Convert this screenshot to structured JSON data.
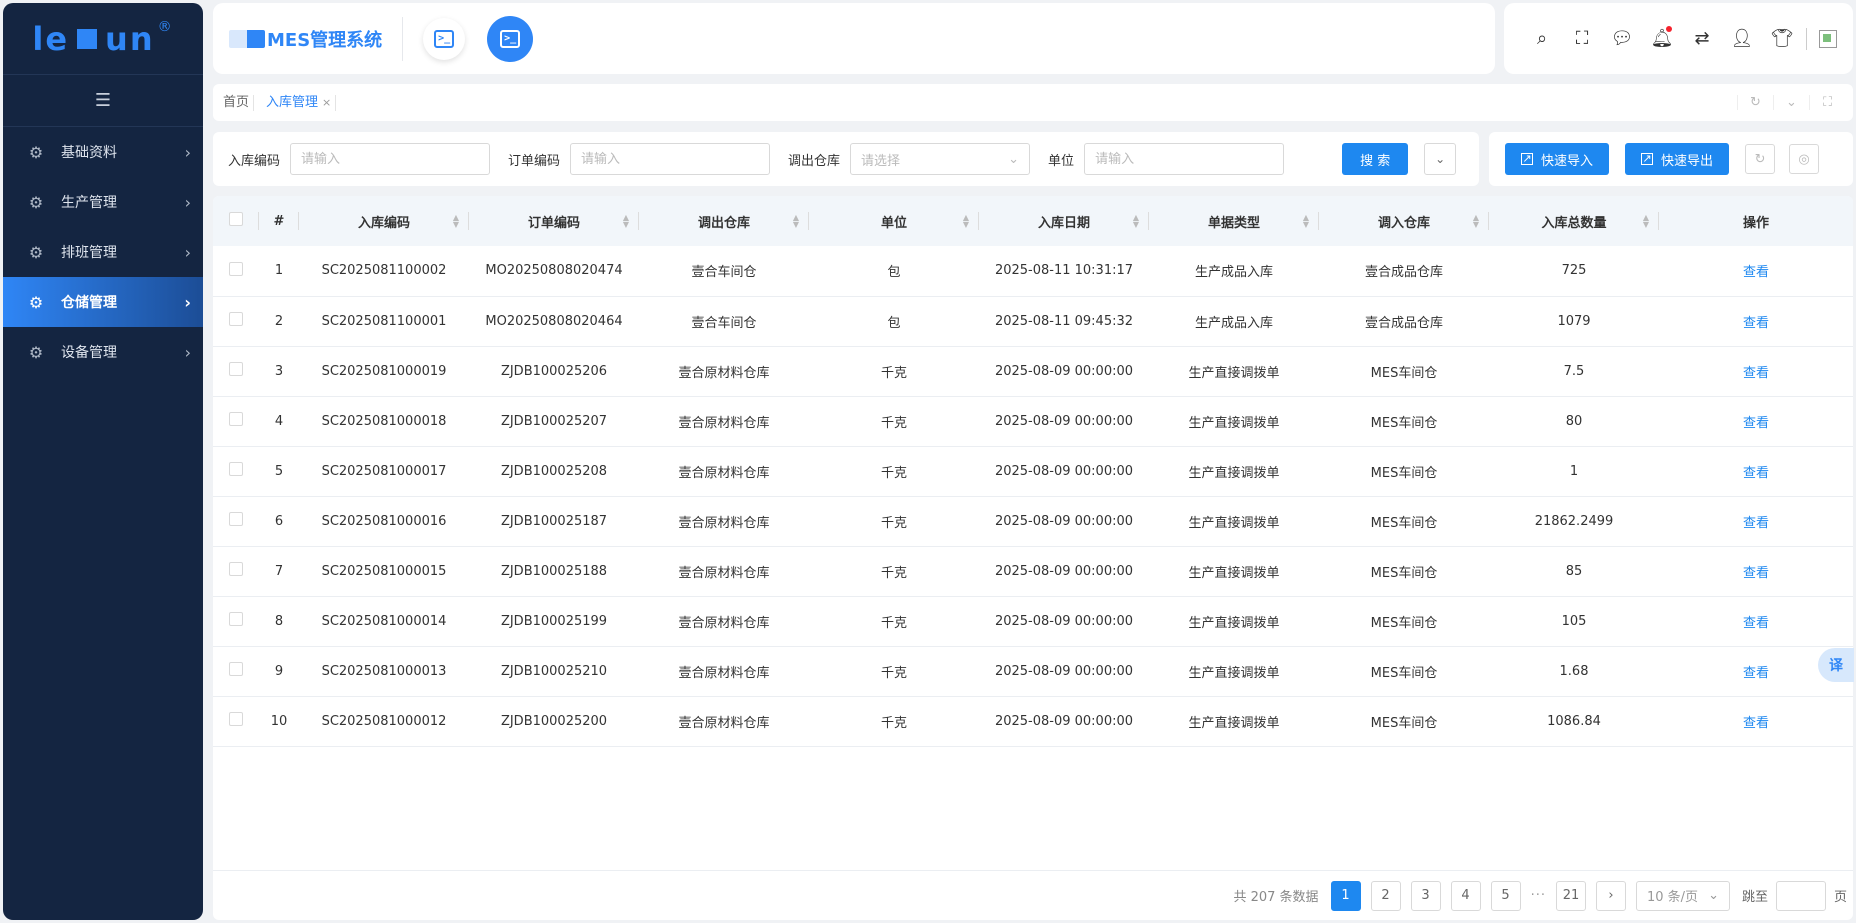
{
  "brand": {
    "logo_left": "le",
    "logo_right": "un",
    "logo_reg": "®"
  },
  "sidebar": {
    "collapse_icon": "menu-collapse-icon",
    "items": [
      {
        "label": "基础资料",
        "icon": "gear-icon",
        "active": false
      },
      {
        "label": "生产管理",
        "icon": "gear-icon",
        "active": false
      },
      {
        "label": "排班管理",
        "icon": "gear-icon",
        "active": false
      },
      {
        "label": "仓储管理",
        "icon": "gear-icon",
        "active": true
      },
      {
        "label": "设备管理",
        "icon": "gear-icon",
        "active": false
      }
    ]
  },
  "header": {
    "system_name": "MES管理系统",
    "tools": [
      "search-icon",
      "fullscreen-icon",
      "message-icon",
      "bell-icon",
      "translate-icon",
      "user-icon",
      "theme-icon"
    ]
  },
  "tabs": [
    {
      "label": "首页",
      "active": false
    },
    {
      "label": "入库管理",
      "active": true,
      "close": "×"
    }
  ],
  "search": {
    "fields": [
      {
        "label": "入库编码",
        "placeholder": "请输入"
      },
      {
        "label": "订单编码",
        "placeholder": "请输入"
      },
      {
        "label": "调出仓库",
        "placeholder": "请选择"
      },
      {
        "label": "单位",
        "placeholder": "请输入"
      }
    ],
    "search_label": "搜 索"
  },
  "actions": {
    "import_label": "快速导入",
    "export_label": "快速导出"
  },
  "table": {
    "columns": [
      "#",
      "入库编码",
      "订单编码",
      "调出仓库",
      "单位",
      "入库日期",
      "单据类型",
      "调入仓库",
      "入库总数量",
      "操作"
    ],
    "rows": [
      [
        "1",
        "SC2025081100002",
        "MO20250808020474",
        "壹合车间仓",
        "包",
        "2025-08-11 10:31:17",
        "生产成品入库",
        "壹合成品仓库",
        "725",
        "查看"
      ],
      [
        "2",
        "SC2025081100001",
        "MO20250808020464",
        "壹合车间仓",
        "包",
        "2025-08-11 09:45:32",
        "生产成品入库",
        "壹合成品仓库",
        "1079",
        "查看"
      ],
      [
        "3",
        "SC2025081000019",
        "ZJDB100025206",
        "壹合原材料仓库",
        "千克",
        "2025-08-09 00:00:00",
        "生产直接调拨单",
        "MES车间仓",
        "7.5",
        "查看"
      ],
      [
        "4",
        "SC2025081000018",
        "ZJDB100025207",
        "壹合原材料仓库",
        "千克",
        "2025-08-09 00:00:00",
        "生产直接调拨单",
        "MES车间仓",
        "80",
        "查看"
      ],
      [
        "5",
        "SC2025081000017",
        "ZJDB100025208",
        "壹合原材料仓库",
        "千克",
        "2025-08-09 00:00:00",
        "生产直接调拨单",
        "MES车间仓",
        "1",
        "查看"
      ],
      [
        "6",
        "SC2025081000016",
        "ZJDB100025187",
        "壹合原材料仓库",
        "千克",
        "2025-08-09 00:00:00",
        "生产直接调拨单",
        "MES车间仓",
        "21862.2499",
        "查看"
      ],
      [
        "7",
        "SC2025081000015",
        "ZJDB100025188",
        "壹合原材料仓库",
        "千克",
        "2025-08-09 00:00:00",
        "生产直接调拨单",
        "MES车间仓",
        "85",
        "查看"
      ],
      [
        "8",
        "SC2025081000014",
        "ZJDB100025199",
        "壹合原材料仓库",
        "千克",
        "2025-08-09 00:00:00",
        "生产直接调拨单",
        "MES车间仓",
        "105",
        "查看"
      ],
      [
        "9",
        "SC2025081000013",
        "ZJDB100025210",
        "壹合原材料仓库",
        "千克",
        "2025-08-09 00:00:00",
        "生产直接调拨单",
        "MES车间仓",
        "1.68",
        "查看"
      ],
      [
        "10",
        "SC2025081000012",
        "ZJDB100025200",
        "壹合原材料仓库",
        "千克",
        "2025-08-09 00:00:00",
        "生产直接调拨单",
        "MES车间仓",
        "1086.84",
        "查看"
      ]
    ]
  },
  "pagination": {
    "total_text": "共 207 条数据",
    "pages": [
      "1",
      "2",
      "3",
      "4",
      "5"
    ],
    "ellipsis": "···",
    "last_page": "21",
    "next": "›",
    "page_size": "10 条/页",
    "jump_label": "跳至",
    "jump_suffix": "页"
  },
  "translate_fab": "译",
  "colors": {
    "accent": "#1e88f0",
    "sidebar_bg": "#142541"
  }
}
